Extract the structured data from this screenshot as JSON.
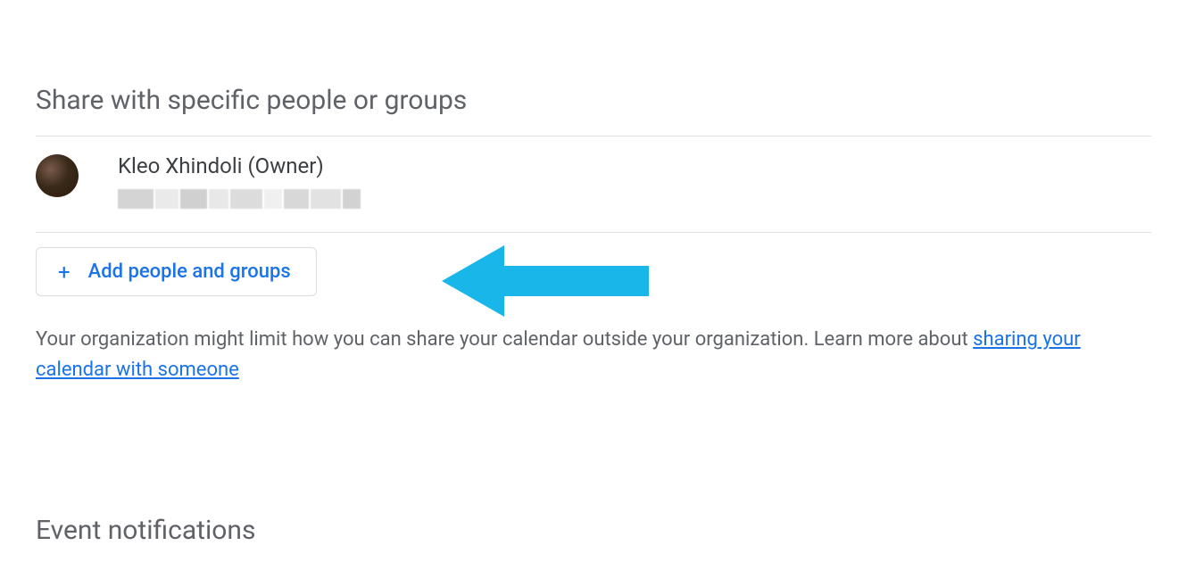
{
  "share_section": {
    "title": "Share with specific people or groups",
    "person": {
      "name": "Kleo Xhindoli (Owner)"
    },
    "add_button": {
      "label": "Add people and groups"
    },
    "helper_text_pre": "Your organization might limit how you can share your calendar outside your organization. Learn more about ",
    "helper_link": "sharing your calendar with someone"
  },
  "notifications_section": {
    "title": "Event notifications"
  },
  "colors": {
    "accent": "#1a73e8",
    "arrow": "#19b6e9"
  }
}
